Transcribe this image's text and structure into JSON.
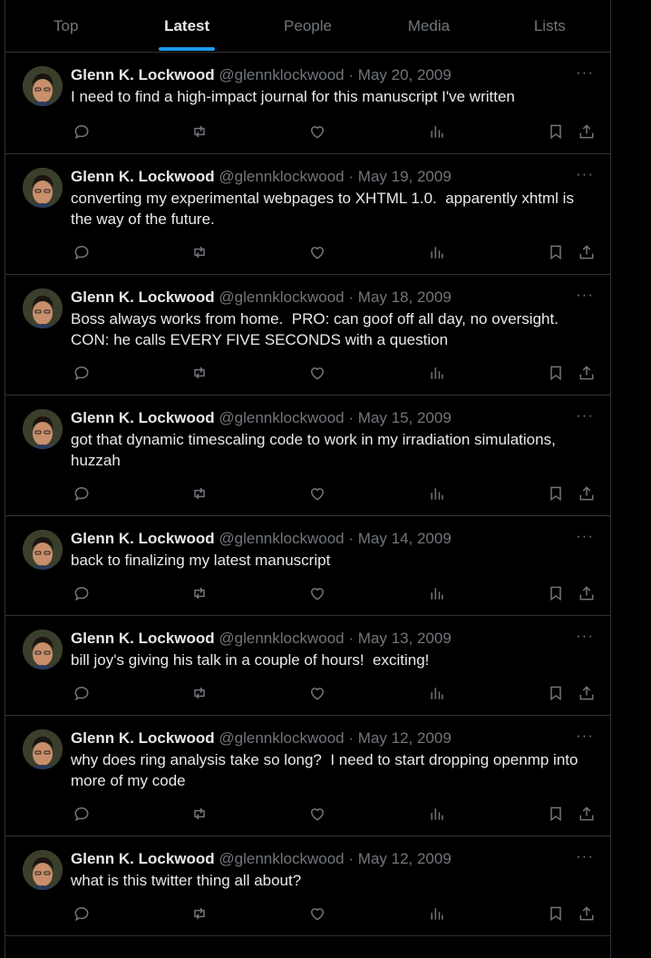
{
  "tabs": [
    {
      "label": "Top",
      "active": false
    },
    {
      "label": "Latest",
      "active": true
    },
    {
      "label": "People",
      "active": false
    },
    {
      "label": "Media",
      "active": false
    },
    {
      "label": "Lists",
      "active": false
    }
  ],
  "tweets": [
    {
      "name": "Glenn K. Lockwood",
      "handle": "@glennklockwood",
      "date": "May 20, 2009",
      "text": "I need to find a high-impact journal for this manuscript I've written"
    },
    {
      "name": "Glenn K. Lockwood",
      "handle": "@glennklockwood",
      "date": "May 19, 2009",
      "text": "converting my experimental webpages to XHTML 1.0.  apparently xhtml is the way of the future."
    },
    {
      "name": "Glenn K. Lockwood",
      "handle": "@glennklockwood",
      "date": "May 18, 2009",
      "text": "Boss always works from home.  PRO: can goof off all day, no oversight.  CON: he calls EVERY FIVE SECONDS with a question"
    },
    {
      "name": "Glenn K. Lockwood",
      "handle": "@glennklockwood",
      "date": "May 15, 2009",
      "text": "got that dynamic timescaling code to work in my irradiation simulations, huzzah"
    },
    {
      "name": "Glenn K. Lockwood",
      "handle": "@glennklockwood",
      "date": "May 14, 2009",
      "text": "back to finalizing my latest manuscript"
    },
    {
      "name": "Glenn K. Lockwood",
      "handle": "@glennklockwood",
      "date": "May 13, 2009",
      "text": "bill joy's giving his talk in a couple of hours!  exciting!"
    },
    {
      "name": "Glenn K. Lockwood",
      "handle": "@glennklockwood",
      "date": "May 12, 2009",
      "text": "why does ring analysis take so long?  I need to start dropping openmp into more of my code"
    },
    {
      "name": "Glenn K. Lockwood",
      "handle": "@glennklockwood",
      "date": "May 12, 2009",
      "text": "what is this twitter thing all about?"
    }
  ],
  "separator": "·",
  "more_label": "···",
  "colors": {
    "background": "#000000",
    "text": "#e7e9ea",
    "muted": "#71767b",
    "accent": "#1d9bf0",
    "border": "#2f3336"
  }
}
